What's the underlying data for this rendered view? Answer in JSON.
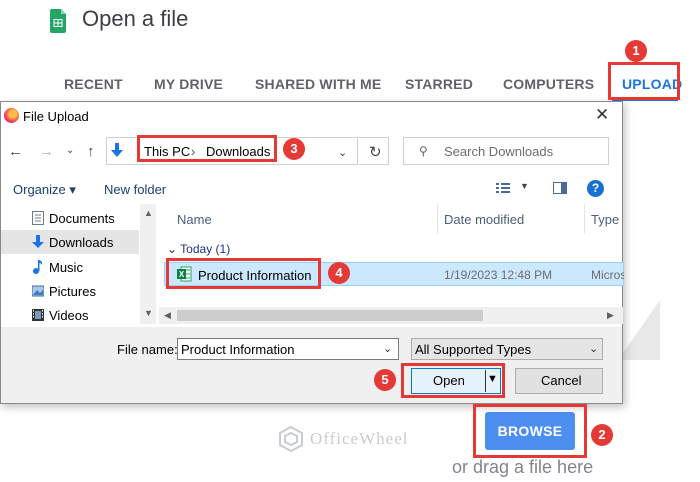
{
  "picker": {
    "title": "Open a file",
    "tabs": [
      {
        "label": "RECENT"
      },
      {
        "label": "MY DRIVE"
      },
      {
        "label": "SHARED WITH ME"
      },
      {
        "label": "STARRED"
      },
      {
        "label": "COMPUTERS"
      },
      {
        "label": "UPLOAD",
        "active": true
      }
    ],
    "browse_label": "BROWSE",
    "drag_text": "or drag a file here",
    "watermark": "OfficeWheel"
  },
  "dialog": {
    "title": "File Upload",
    "close_glyph": "✕",
    "breadcrumb": [
      "This PC",
      "Downloads"
    ],
    "search_placeholder": "Search Downloads",
    "toolbar": {
      "organize": "Organize ▾",
      "new_folder": "New folder"
    },
    "sidebar": [
      {
        "label": "Documents",
        "icon": "documents-icon"
      },
      {
        "label": "Downloads",
        "icon": "downloads-icon",
        "selected": true
      },
      {
        "label": "Music",
        "icon": "music-icon"
      },
      {
        "label": "Pictures",
        "icon": "pictures-icon"
      },
      {
        "label": "Videos",
        "icon": "videos-icon"
      }
    ],
    "columns": {
      "name": "Name",
      "date": "Date modified",
      "type": "Type"
    },
    "group": "Today (1)",
    "file": {
      "name": "Product Information",
      "date": "1/19/2023 12:48 PM",
      "type": "Microsoft Excel Worksheet"
    },
    "file_name_label": "File name:",
    "file_name_value": "Product Information",
    "file_type": "All Supported Types",
    "open_label": "Open",
    "cancel_label": "Cancel"
  },
  "steps": [
    "1",
    "2",
    "3",
    "4",
    "5"
  ],
  "colors": {
    "accent": "#1a73e8",
    "annotation": "#e53935",
    "selection": "#cce8ff"
  }
}
